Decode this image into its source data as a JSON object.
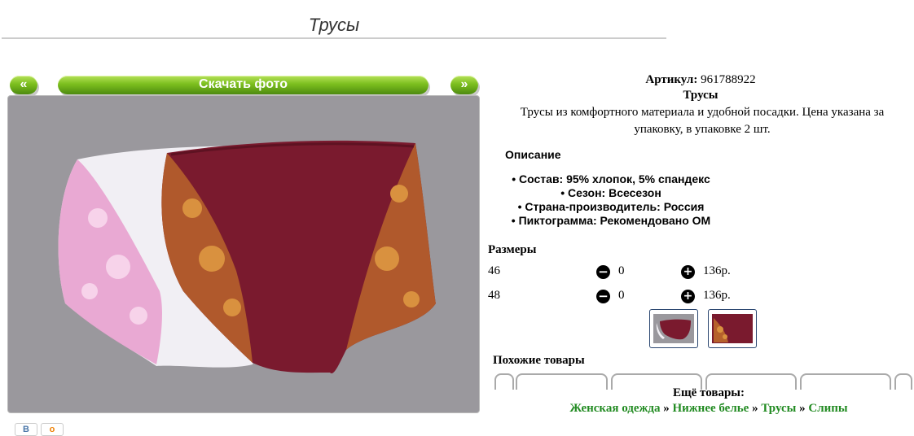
{
  "page": {
    "title": "Трусы"
  },
  "gallery": {
    "prev_label": "«",
    "next_label": "»",
    "download_label": "Скачать фото"
  },
  "product": {
    "article_label": "Артикул:",
    "article_value": "961788922",
    "name": "Трусы",
    "description": "Трусы из комфортного материала и удобной посадки. Цена указана за упаковку, в упаковке 2 шт.",
    "description_heading": "Описание",
    "properties": [
      "Состав: 95% хлопок, 5% спандекс",
      "Сезон: Всесезон",
      "Страна-производитель: Россия",
      "Пиктограмма: Рекомендовано ОМ"
    ]
  },
  "sizes": {
    "heading": "Размеры",
    "minus_icon": "minus-circle-icon",
    "plus_icon": "plus-circle-icon",
    "rows": [
      {
        "size": "46",
        "qty": "0",
        "price": "136р."
      },
      {
        "size": "48",
        "qty": "0",
        "price": "136р."
      }
    ]
  },
  "similar": {
    "heading": "Похожие товары"
  },
  "more": {
    "heading": "Ещё товары:",
    "separator": "»",
    "links": [
      "Женская одежда",
      "Нижнее белье",
      "Трусы",
      "Слипы"
    ]
  },
  "social": {
    "vk_label": "В",
    "ok_label": "о"
  },
  "colors": {
    "accent_green": "#7cbf1e",
    "link_green": "#228b22",
    "burgundy": "#7a1a2e",
    "photo_bg": "#9a989d"
  }
}
